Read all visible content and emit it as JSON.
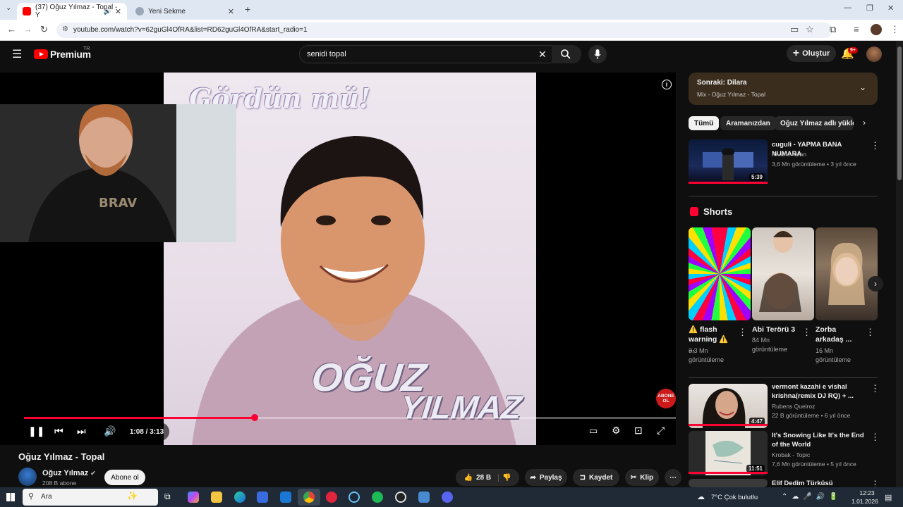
{
  "browser": {
    "tabs": [
      {
        "label": "(37) Oğuz Yılmaz - Topal - Y"
      },
      {
        "label": "Yeni Sekme"
      }
    ],
    "url": "youtube.com/watch?v=62guGl4OfRA&list=RD62guGl4OfRA&start_radio=1"
  },
  "header": {
    "logo": "Premium",
    "logo_region": "TR",
    "search_value": "senidi topal",
    "create_label": "Oluştur",
    "notif_badge": "9+"
  },
  "player": {
    "time": "1:08 / 3:13",
    "progress": 0.354,
    "cover_title": "Gördün mü!",
    "cover_artist_line1": "OĞUZ",
    "cover_artist_line2": "YILMAZ",
    "subscribe_watermark": "ABONE OL"
  },
  "video": {
    "title": "Oğuz Yılmaz - Topal",
    "channel": "Oğuz Yılmaz",
    "subscribers": "208 B abone",
    "subscribe_label": "Abone ol",
    "likes": "28 B",
    "share_label": "Paylaş",
    "save_label": "Kaydet",
    "clip_label": "Klip"
  },
  "upnext": {
    "title": "Sonraki: Dilara",
    "subtitle": "Mix - Oğuz Yılmaz - Topal"
  },
  "chips": [
    "Tümü",
    "Aramanızdan",
    "Oğuz Yılmaz adlı yükleyici"
  ],
  "related_top": {
    "title": "cuguli - YAPMA BANA NUMARA",
    "channel": "Kıvanc Aslan",
    "meta": "3,6 Mn görüntüleme • 3 yıl önce",
    "duration": "5:39"
  },
  "shorts": {
    "heading": "Shorts",
    "items": [
      {
        "title": "⚠️ flash warning ⚠️ ...",
        "views": "3,3 Mn görüntüleme"
      },
      {
        "title": "Abi Terörü 3",
        "views": "84 Mn görüntüleme"
      },
      {
        "title": "Zorba arkadaş ...",
        "views": "16 Mn görüntüleme"
      }
    ]
  },
  "related": [
    {
      "title": "vermont kazahi e vishal krishna(remix DJ RQ) + ...",
      "channel": "Rubens Queiroz",
      "meta": "22 B görüntüleme • 6 yıl önce",
      "duration": "4:47"
    },
    {
      "title": "It's Snowing Like It's the End of the World",
      "channel": "Krobak - Topic",
      "meta": "7,6 Mn görüntüleme • 5 yıl önce",
      "duration": "11:51"
    },
    {
      "title": "Elif Dedim Türküsü",
      "channel": "",
      "meta": "",
      "duration": ""
    }
  ],
  "taskbar": {
    "search_placeholder": "Ara",
    "weather": "7°C  Çok bulutlu",
    "time": "12:23",
    "date": "1.01.2026"
  },
  "colors": {
    "accent": "#ff0033",
    "bg": "#0f0f0f",
    "chip_bg": "#272727"
  }
}
